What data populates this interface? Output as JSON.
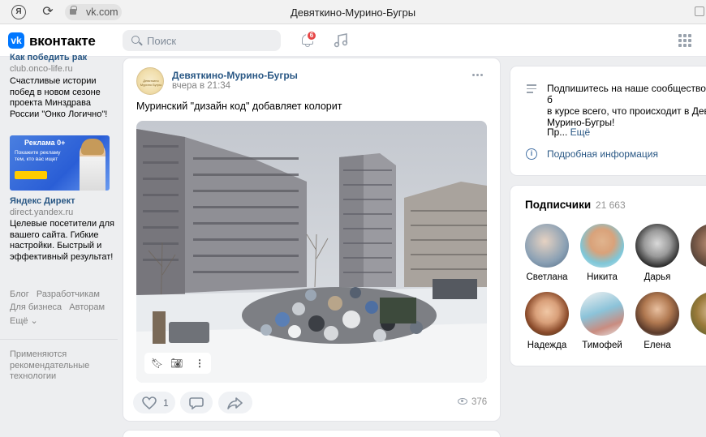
{
  "browser": {
    "yandex_icon": "Я",
    "url": "vk.com",
    "tab_title": "Девяткино-Мурино-Бугры"
  },
  "header": {
    "logo_letter": "vk",
    "brand": "вконтакте",
    "search_placeholder": "Поиск",
    "notifications_count": "6",
    "accent_color": "#0077ff"
  },
  "sidebar": {
    "ad1": {
      "title_cut": "Как победить рак",
      "domain": "club.onco-life.ru",
      "text": "Счастливые истории побед в новом сезоне проекта Минздрава России \"Онко Логично\"!"
    },
    "ad2": {
      "banner_title": "Реклама 0+",
      "banner_text": "Покажите рекламу тем, кто вас ищет",
      "name": "Яндекс Директ",
      "domain": "direct.yandex.ru",
      "text": "Целевые посетители для вашего сайта. Гибкие настройки. Быстрый и эффективный результат!"
    },
    "links": [
      "Блог",
      "Разработчикам",
      "Для бизнеса",
      "Авторам",
      "Ещё ⌄"
    ],
    "tech_note": "Применяются рекомендательные технологии"
  },
  "post": {
    "author": "Девяткино-Мурино-Бугры",
    "time": "вчера в 21:34",
    "text": "Муринский \"дизайн код\" добавляет колорит",
    "likes": "1",
    "views": "376"
  },
  "community_info": {
    "description": "Подпишитесь на наше сообщество и б\nв курсе всего, что происходит в Девя\nМурино-Бугры!",
    "pr_prefix": "Пр...",
    "more_link": "Ещё",
    "details_link": "Подробная информация"
  },
  "subscribers": {
    "title": "Подписчики",
    "count": "21 663",
    "people": [
      {
        "name": "Светлана"
      },
      {
        "name": "Никита"
      },
      {
        "name": "Дарья"
      },
      {
        "name": "Се"
      },
      {
        "name": "Надежда"
      },
      {
        "name": "Тимофей"
      },
      {
        "name": "Елена"
      },
      {
        "name": "Ко"
      }
    ]
  }
}
